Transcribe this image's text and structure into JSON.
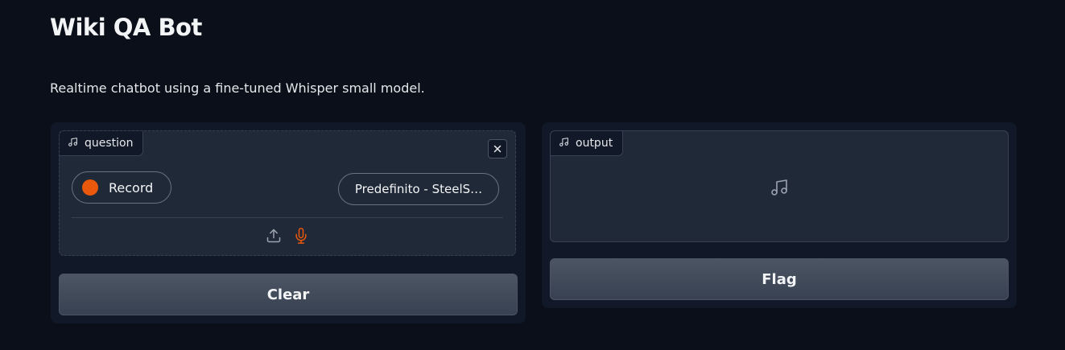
{
  "header": {
    "title": "Wiki QA Bot",
    "description": "Realtime chatbot using a fine-tuned Whisper small model."
  },
  "input_audio": {
    "label": "question",
    "record_label": "Record",
    "device_selected": "Predefinito - SteelS…",
    "icons": [
      "music-note-icon",
      "close-icon",
      "upload-icon",
      "microphone-icon"
    ]
  },
  "output_audio": {
    "label": "output",
    "icons": [
      "music-note-icon"
    ]
  },
  "actions": {
    "clear_label": "Clear",
    "flag_label": "Flag"
  },
  "colors": {
    "background": "#0b0f19",
    "panel": "#111827",
    "block": "#1f2937",
    "accent": "#ea580c"
  }
}
